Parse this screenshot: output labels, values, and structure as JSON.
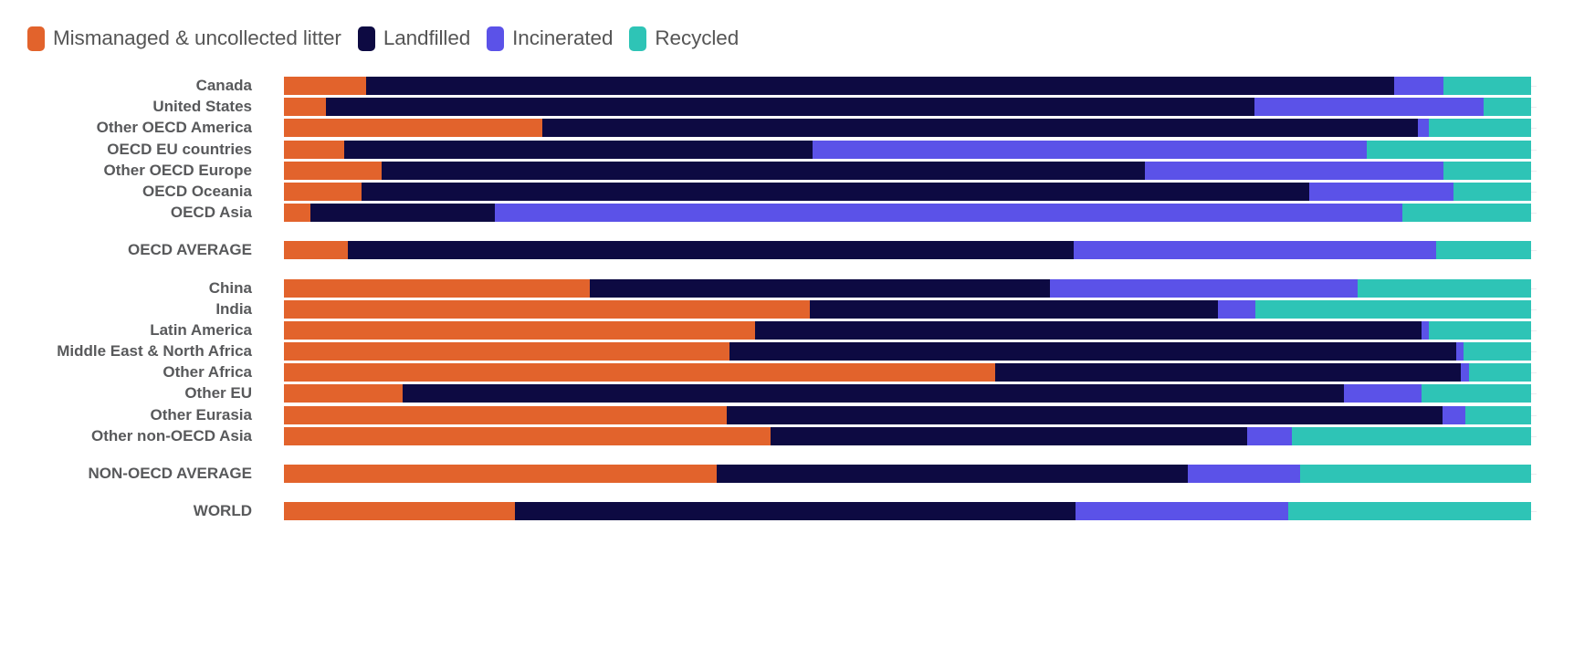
{
  "legend": {
    "items": [
      {
        "label": "Mismanaged & uncollected litter",
        "color": "#e2632c",
        "key": "mismanaged"
      },
      {
        "label": "Landfilled",
        "color": "#0d0a42",
        "key": "landfilled"
      },
      {
        "label": "Incinerated",
        "color": "#5b52e8",
        "key": "incinerated"
      },
      {
        "label": "Recycled",
        "color": "#2ec4b6",
        "key": "recycled"
      }
    ]
  },
  "chart_data": {
    "type": "bar",
    "orientation": "horizontal",
    "stacked": true,
    "normalized_percent": true,
    "title": "",
    "xlabel": "",
    "ylabel": "",
    "xlim": [
      0,
      100
    ],
    "grid": true,
    "legend_position": "top-left",
    "series": [
      {
        "name": "Mismanaged & uncollected litter",
        "color": "#e2632c"
      },
      {
        "name": "Landfilled",
        "color": "#0d0a42"
      },
      {
        "name": "Incinerated",
        "color": "#5b52e8"
      },
      {
        "name": "Recycled",
        "color": "#2ec4b6"
      }
    ],
    "categories": [
      "Canada",
      "United States",
      "Other OECD America",
      "OECD EU countries",
      "Other OECD Europe",
      "OECD Oceania",
      "OECD Asia",
      "OECD AVERAGE",
      "China",
      "India",
      "Latin America",
      "Middle East & North Africa",
      "Other Africa",
      "Other EU",
      "Other Eurasia",
      "Other non-OECD Asia",
      "NON-OECD AVERAGE",
      "WORLD"
    ],
    "rows": [
      {
        "label": "Canada",
        "group": "oecd",
        "mismanaged": 6.6,
        "landfilled": 82.4,
        "incinerated": 4.0,
        "recycled": 7.0
      },
      {
        "label": "United States",
        "group": "oecd",
        "mismanaged": 3.4,
        "landfilled": 74.4,
        "incinerated": 18.4,
        "recycled": 3.8
      },
      {
        "label": "Other OECD America",
        "group": "oecd",
        "mismanaged": 20.7,
        "landfilled": 70.2,
        "incinerated": 0.9,
        "recycled": 8.2
      },
      {
        "label": "OECD EU countries",
        "group": "oecd",
        "mismanaged": 4.8,
        "landfilled": 37.6,
        "incinerated": 44.4,
        "recycled": 13.2
      },
      {
        "label": "Other OECD Europe",
        "group": "oecd",
        "mismanaged": 7.8,
        "landfilled": 61.2,
        "incinerated": 24.0,
        "recycled": 7.0
      },
      {
        "label": "OECD Oceania",
        "group": "oecd",
        "mismanaged": 6.2,
        "landfilled": 76.0,
        "incinerated": 11.6,
        "recycled": 6.2
      },
      {
        "label": "OECD Asia",
        "group": "oecd",
        "mismanaged": 2.1,
        "landfilled": 14.8,
        "incinerated": 72.8,
        "recycled": 10.3
      },
      {
        "label": "OECD AVERAGE",
        "group": "oecd-average",
        "mismanaged": 5.1,
        "landfilled": 58.2,
        "incinerated": 29.1,
        "recycled": 7.6
      },
      {
        "label": "China",
        "group": "nonoecd",
        "mismanaged": 24.5,
        "landfilled": 36.9,
        "incinerated": 24.7,
        "recycled": 13.9
      },
      {
        "label": "India",
        "group": "nonoecd",
        "mismanaged": 42.2,
        "landfilled": 32.7,
        "incinerated": 3.0,
        "recycled": 22.1
      },
      {
        "label": "Latin America",
        "group": "nonoecd",
        "mismanaged": 37.8,
        "landfilled": 53.4,
        "incinerated": 0.6,
        "recycled": 8.2
      },
      {
        "label": "Middle East & North Africa",
        "group": "nonoecd",
        "mismanaged": 35.7,
        "landfilled": 58.3,
        "incinerated": 0.6,
        "recycled": 5.4
      },
      {
        "label": "Other Africa",
        "group": "nonoecd",
        "mismanaged": 57.0,
        "landfilled": 37.4,
        "incinerated": 0.6,
        "recycled": 5.0
      },
      {
        "label": "Other EU",
        "group": "nonoecd",
        "mismanaged": 9.5,
        "landfilled": 75.5,
        "incinerated": 6.2,
        "recycled": 8.8
      },
      {
        "label": "Other Eurasia",
        "group": "nonoecd",
        "mismanaged": 35.5,
        "landfilled": 57.4,
        "incinerated": 1.8,
        "recycled": 5.3
      },
      {
        "label": "Other non-OECD Asia",
        "group": "nonoecd",
        "mismanaged": 39.0,
        "landfilled": 38.2,
        "incinerated": 3.6,
        "recycled": 19.2
      },
      {
        "label": "NON-OECD AVERAGE",
        "group": "nonoecd-average",
        "mismanaged": 34.7,
        "landfilled": 37.8,
        "incinerated": 9.0,
        "recycled": 18.5
      },
      {
        "label": "WORLD",
        "group": "world",
        "mismanaged": 18.5,
        "landfilled": 45.0,
        "incinerated": 17.0,
        "recycled": 19.5
      }
    ]
  }
}
